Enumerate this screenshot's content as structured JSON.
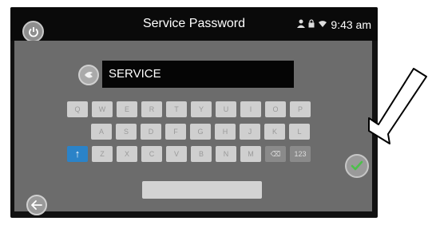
{
  "header": {
    "title": "Service Password",
    "time": "9:43 am",
    "icons": [
      "person-icon",
      "lock-icon",
      "wifi-icon"
    ]
  },
  "password_field": {
    "value": "SERVICE"
  },
  "keyboard": {
    "row1": [
      "Q",
      "W",
      "E",
      "R",
      "T",
      "Y",
      "U",
      "I",
      "O",
      "P"
    ],
    "row2": [
      "A",
      "S",
      "D",
      "F",
      "G",
      "H",
      "J",
      "K",
      "L"
    ],
    "row3": [
      "↑",
      "Z",
      "X",
      "C",
      "V",
      "B",
      "N",
      "M",
      "⌫",
      "123"
    ]
  },
  "buttons": {
    "power": "power-icon",
    "confirm": "checkmark-icon",
    "back": "back-arrow-icon"
  },
  "colors": {
    "panel": "#6c6c6c",
    "shift_key": "#2b83c8",
    "checkmark": "#4cc04a"
  }
}
